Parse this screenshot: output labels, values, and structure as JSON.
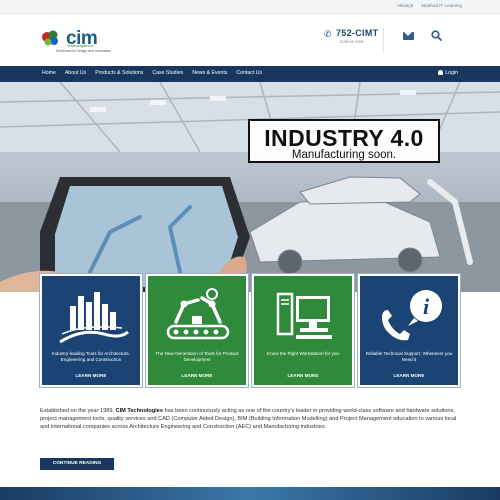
{
  "topbar": {
    "links": [
      "Alexarjit",
      "Stanford IT Learning"
    ]
  },
  "logo": {
    "wordmark": "cim",
    "tagline_top": "Technologies Inc.",
    "tagline_bottom": "Solutions for Design and Innovation"
  },
  "contact": {
    "phone": "752-CIMT",
    "call_label": "Call us now"
  },
  "icons": {
    "mail": "mail-icon",
    "search": "search-icon",
    "phone": "phone-icon",
    "user": "user-icon"
  },
  "nav": {
    "items": [
      "Home",
      "About Us",
      "Products & Solutions",
      "Case Studies",
      "News & Events",
      "Contact Us"
    ],
    "login": "Login"
  },
  "hero": {
    "title": "INDUSTRY 4.0",
    "subtitle": "Manufacturing soon."
  },
  "cards": [
    {
      "text": "Industry-leading Tools for Architecture, Engineering and Construction",
      "more": "LEARN MORE",
      "color": "#1b4475",
      "icon": "city-skyline-icon"
    },
    {
      "text": "The New Generation of Tools for Product Development",
      "more": "LEARN MORE",
      "color": "#2f8a3c",
      "icon": "robot-arm-conveyor-icon"
    },
    {
      "text": "Know the Right Workstation for you",
      "more": "LEARN MORE",
      "color": "#2f8a3c",
      "icon": "workstation-icon"
    },
    {
      "text": "Reliable Technical Support, Whenever you Need it",
      "more": "LEARN MORE",
      "color": "#1b4475",
      "icon": "support-info-icon"
    }
  ],
  "intro": {
    "lead": "Established on the year 1989, ",
    "company": "CIM Technologies",
    "text": " has been continuously acting as one of the country's leader in providing world-class software and hardware solutions, project management tools, quality services and CAD (Computer Aided Design), BIM (Building Information Modelling) and Project Management  education to various local and international companies across  Architecture Engineering and Construction (AEC) and Manufacturing industries."
  },
  "cta": {
    "label": "CONTINUE READING"
  },
  "colors": {
    "navy": "#17375e",
    "card_blue": "#1b4475",
    "card_green": "#2f8a3c"
  }
}
